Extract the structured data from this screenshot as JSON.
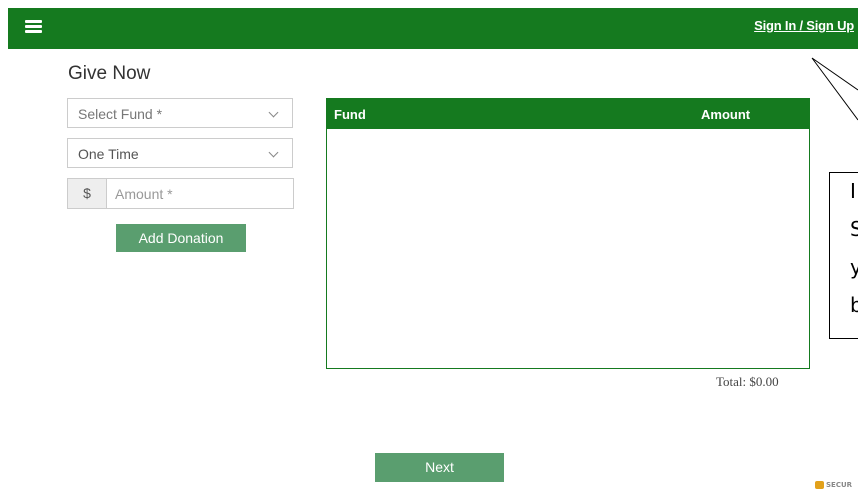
{
  "header": {
    "signin_label": "Sign In / Sign Up"
  },
  "page": {
    "title": "Give Now"
  },
  "form": {
    "fund_select": "Select Fund *",
    "frequency_select": "One Time",
    "currency_symbol": "$",
    "amount_placeholder": "Amount *",
    "add_button": "Add Donation"
  },
  "table": {
    "col_fund": "Fund",
    "col_amount": "Amount",
    "rows": []
  },
  "summary": {
    "total": "Total: $0.00"
  },
  "footer": {
    "next_button": "Next",
    "secure_badge": "SECUR"
  },
  "callout": {
    "lines": [
      "I",
      "S",
      "y",
      "b"
    ]
  },
  "colors": {
    "brand_green": "#157a1f",
    "button_green": "#5a9e6f"
  },
  "icons": {
    "menu": "hamburger-icon",
    "lock": "lock-icon"
  }
}
